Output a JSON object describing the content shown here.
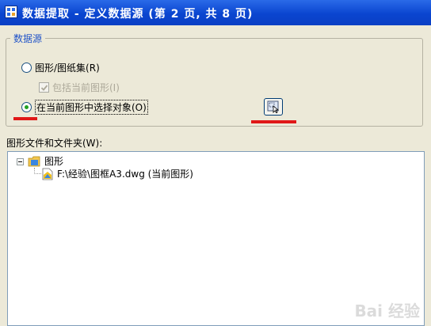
{
  "window": {
    "title": "数据提取 - 定义数据源 (第 2 页, 共 8 页)",
    "icon": "data-extraction-app-icon"
  },
  "datasource": {
    "legend": "数据源",
    "option_drawings_label": "图形/图纸集(R)",
    "option_drawings_selected": false,
    "include_current_label": "包括当前图形(I)",
    "include_current_checked": true,
    "include_current_enabled": false,
    "option_select_objects_label": "在当前图形中选择对象(O)",
    "option_select_objects_selected": true,
    "pick_button_icon": "select-objects-icon"
  },
  "tree": {
    "label": "图形文件和文件夹(W):",
    "root": {
      "label": "图形",
      "expanded": true,
      "children": [
        {
          "label": "F:\\经验\\图框A3.dwg (当前图形)"
        }
      ]
    }
  },
  "annotations": {
    "underline_color": "#e01818"
  },
  "watermark": {
    "text": "Bai 经验"
  },
  "colors": {
    "title_bar": "#0a45d0",
    "group_legend": "#2154c8",
    "radio_dot": "#21a121"
  }
}
